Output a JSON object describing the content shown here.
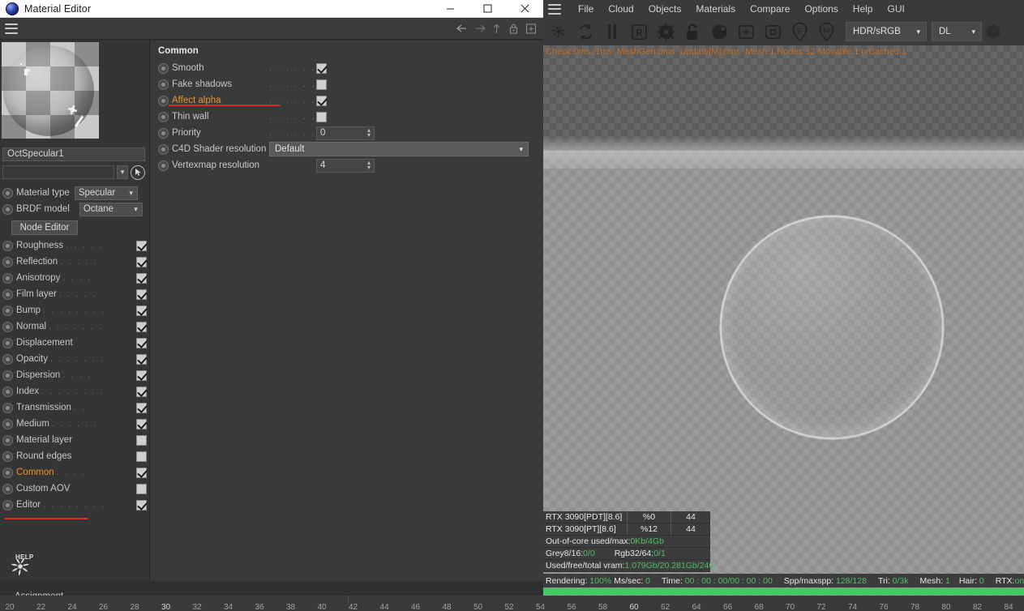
{
  "window": {
    "title": "Material Editor",
    "icon": "octane-sphere-icon",
    "minimize": "minimize-icon",
    "maximize": "maximize-icon",
    "close": "close-icon"
  },
  "editor_toolbar": {
    "menu": "hamburger-icon",
    "back": "←",
    "forward": "→",
    "up": "↑",
    "lock": "lock-icon",
    "add": "add-panel-icon"
  },
  "material": {
    "name_value": "OctSpecular1",
    "search_value": "",
    "picker": "eyedropper-icon",
    "material_type_label": "Material type",
    "material_type_value": "Specular",
    "brdf_label": "BRDF model",
    "brdf_value": "Octane",
    "node_editor_button": "Node Editor",
    "assignment_label": "Assignment",
    "help_label": "HELP",
    "channels": [
      {
        "label": "Roughness",
        "dots": ". . . . .",
        "checked": true,
        "highlight": false
      },
      {
        "label": "Reflection",
        "dots": ". . . . .",
        "checked": true,
        "highlight": false
      },
      {
        "label": "Anisotropy",
        "dots": ". . . .",
        "checked": true,
        "highlight": false
      },
      {
        "label": "Film layer",
        "dots": ". . . . .",
        "checked": true,
        "highlight": false
      },
      {
        "label": "Bump",
        "dots": ". . . . . . . .",
        "checked": true,
        "highlight": false
      },
      {
        "label": "Normal",
        "dots": ". . . . . . .",
        "checked": true,
        "highlight": false
      },
      {
        "label": "Displacement",
        "dots": "",
        "checked": true,
        "highlight": false
      },
      {
        "label": "Opacity",
        "dots": ". . . . . . .",
        "checked": true,
        "highlight": false
      },
      {
        "label": "Dispersion",
        "dots": ". . . .",
        "checked": true,
        "highlight": false
      },
      {
        "label": "Index",
        "dots": ". . . . . . . .",
        "checked": true,
        "highlight": false
      },
      {
        "label": "Transmission",
        "dots": ". .",
        "checked": true,
        "highlight": false
      },
      {
        "label": "Medium",
        "dots": ". . . . . .",
        "checked": true,
        "highlight": false
      },
      {
        "label": "Material layer",
        "dots": "",
        "checked": false,
        "highlight": false
      },
      {
        "label": "Round edges",
        "dots": "",
        "checked": false,
        "highlight": false
      },
      {
        "label": "Common",
        "dots": ". . . .",
        "checked": true,
        "highlight": true
      },
      {
        "label": "Custom AOV",
        "dots": "",
        "checked": false,
        "highlight": false
      },
      {
        "label": "Editor",
        "dots": ". . . . . . . .",
        "checked": true,
        "highlight": false
      }
    ]
  },
  "common_panel": {
    "title": "Common",
    "rows": [
      {
        "label": "Smooth",
        "dots": ". . . . . . . . . .",
        "type": "check",
        "value": true,
        "highlight": false
      },
      {
        "label": "Fake shadows",
        "dots": ". . . . . .",
        "type": "check",
        "value": false,
        "highlight": false
      },
      {
        "label": "Affect alpha",
        "dots": ". . . . . . .",
        "type": "check",
        "value": true,
        "highlight": true
      },
      {
        "label": "Thin wall",
        "dots": ". . . . . . . . .",
        "type": "check",
        "value": false,
        "highlight": false
      },
      {
        "label": "Priority",
        "dots": ". . . . . . . . . .",
        "type": "spin",
        "value": "0",
        "highlight": false
      },
      {
        "label": "C4D Shader resolution",
        "dots": "",
        "type": "select",
        "value": "Default",
        "highlight": false
      },
      {
        "label": "Vertexmap resolution",
        "dots": "",
        "type": "spin",
        "value": "4",
        "highlight": false
      }
    ]
  },
  "octane": {
    "menu_icon": "hamburger-icon",
    "menus": [
      "File",
      "Cloud",
      "Objects",
      "Materials",
      "Compare",
      "Options",
      "Help",
      "GUI"
    ],
    "toolbar_icons": [
      "octane-render-icon",
      "restart-render-icon",
      "pause-icon",
      "region-render-icon",
      "settings-gear-icon",
      "unlock-icon",
      "lighting-sphere-icon",
      "add-region-icon",
      "crop-region-icon",
      "focus-pin-icon",
      "material-pin-icon"
    ],
    "response_value": "HDR/sRGB",
    "kernel_value": "DL",
    "status_line": "Check:0ms./1ms. MeshGen:0ms. Update[M]:0ms. Mesh:1 Nodes:12 Movable:1 txCached:1",
    "stats": {
      "gpus": [
        {
          "name": "RTX 3090[PDT][8.6]",
          "usage": "%0",
          "temp": "44"
        },
        {
          "name": "RTX 3090[PT][8.6]",
          "usage": "%12",
          "temp": "44"
        }
      ],
      "out_of_core_label": "Out-of-core used/max:",
      "out_of_core_value": "0Kb/4Gb",
      "grey_label": "Grey8/16: ",
      "grey_value": "0/0",
      "rgb_label": "Rgb32/64: ",
      "rgb_value": "0/1",
      "vram_label": "Used/free/total vram: ",
      "vram_value": "1.079Gb/20.281Gb/24G"
    },
    "render_status": {
      "rendering_label": "Rendering: ",
      "rendering_value": "100%",
      "ms_label": "Ms/sec: ",
      "ms_value": "0",
      "time_label": "Time: ",
      "time_value": "00 : 00 : 00/00 : 00 : 00",
      "spp_label": "Spp/maxspp: ",
      "spp_value": "128/128",
      "tri_label": "Tri: ",
      "tri_value": "0/3k",
      "mesh_label": "Mesh: ",
      "mesh_value": "1",
      "hair_label": "Hair: ",
      "hair_value": "0",
      "rtx_label": "RTX:",
      "rtx_value": "on"
    }
  },
  "ruler": {
    "ticks": [
      20,
      22,
      24,
      26,
      28,
      30,
      32,
      34,
      36,
      38,
      40,
      42,
      44,
      46,
      48,
      50,
      52,
      54,
      56,
      58,
      60,
      62,
      64,
      66,
      68,
      70,
      72,
      74,
      76,
      78,
      80,
      82,
      84
    ],
    "bold": [
      30,
      60
    ]
  },
  "colors": {
    "accent_orange": "#e8962c",
    "annotation_red": "#e12a20",
    "status_green": "#3ecd5e",
    "value_green": "#4fbf6a",
    "status_orange": "#c8742a"
  }
}
